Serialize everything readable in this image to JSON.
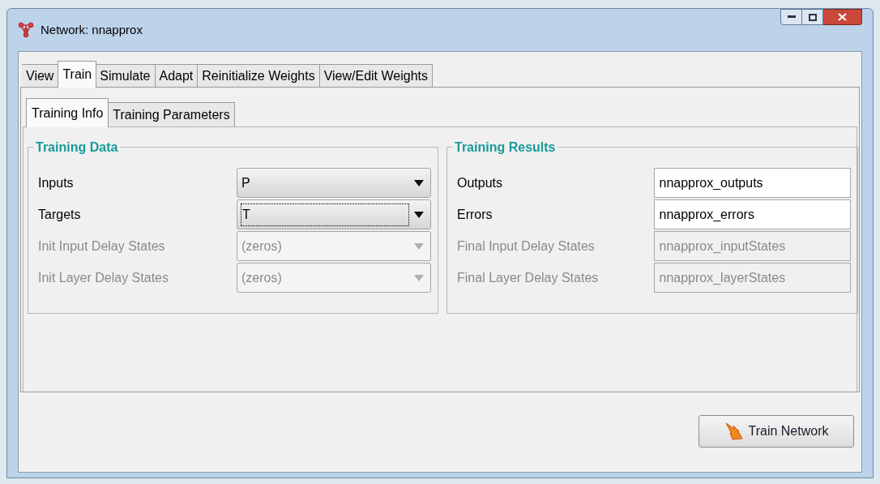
{
  "window": {
    "title": "Network: nnapprox"
  },
  "tabs": [
    {
      "label": "View",
      "selected": false
    },
    {
      "label": "Train",
      "selected": true
    },
    {
      "label": "Simulate",
      "selected": false
    },
    {
      "label": "Adapt",
      "selected": false
    },
    {
      "label": "Reinitialize Weights",
      "selected": false
    },
    {
      "label": "View/Edit Weights",
      "selected": false
    }
  ],
  "subtabs": [
    {
      "label": "Training Info",
      "selected": true
    },
    {
      "label": "Training Parameters",
      "selected": false
    }
  ],
  "groups": [
    {
      "title": "Training Data",
      "rows": [
        {
          "label": "Inputs",
          "kind": "dropdown",
          "value": "P",
          "disabled": false,
          "focused": false
        },
        {
          "label": "Targets",
          "kind": "dropdown",
          "value": "T",
          "disabled": false,
          "focused": true
        },
        {
          "label": "Init Input Delay States",
          "kind": "dropdown",
          "value": "(zeros)",
          "disabled": true,
          "focused": false
        },
        {
          "label": "Init Layer Delay States",
          "kind": "dropdown",
          "value": "(zeros)",
          "disabled": true,
          "focused": false
        }
      ]
    },
    {
      "title": "Training Results",
      "rows": [
        {
          "label": "Outputs",
          "kind": "text",
          "value": "nnapprox_outputs",
          "disabled": false
        },
        {
          "label": "Errors",
          "kind": "text",
          "value": "nnapprox_errors",
          "disabled": false
        },
        {
          "label": "Final Input Delay States",
          "kind": "text",
          "value": "nnapprox_inputStates",
          "disabled": true
        },
        {
          "label": "Final Layer Delay States",
          "kind": "text",
          "value": "nnapprox_layerStates",
          "disabled": true
        }
      ]
    }
  ],
  "train_button": {
    "label": "Train Network"
  }
}
